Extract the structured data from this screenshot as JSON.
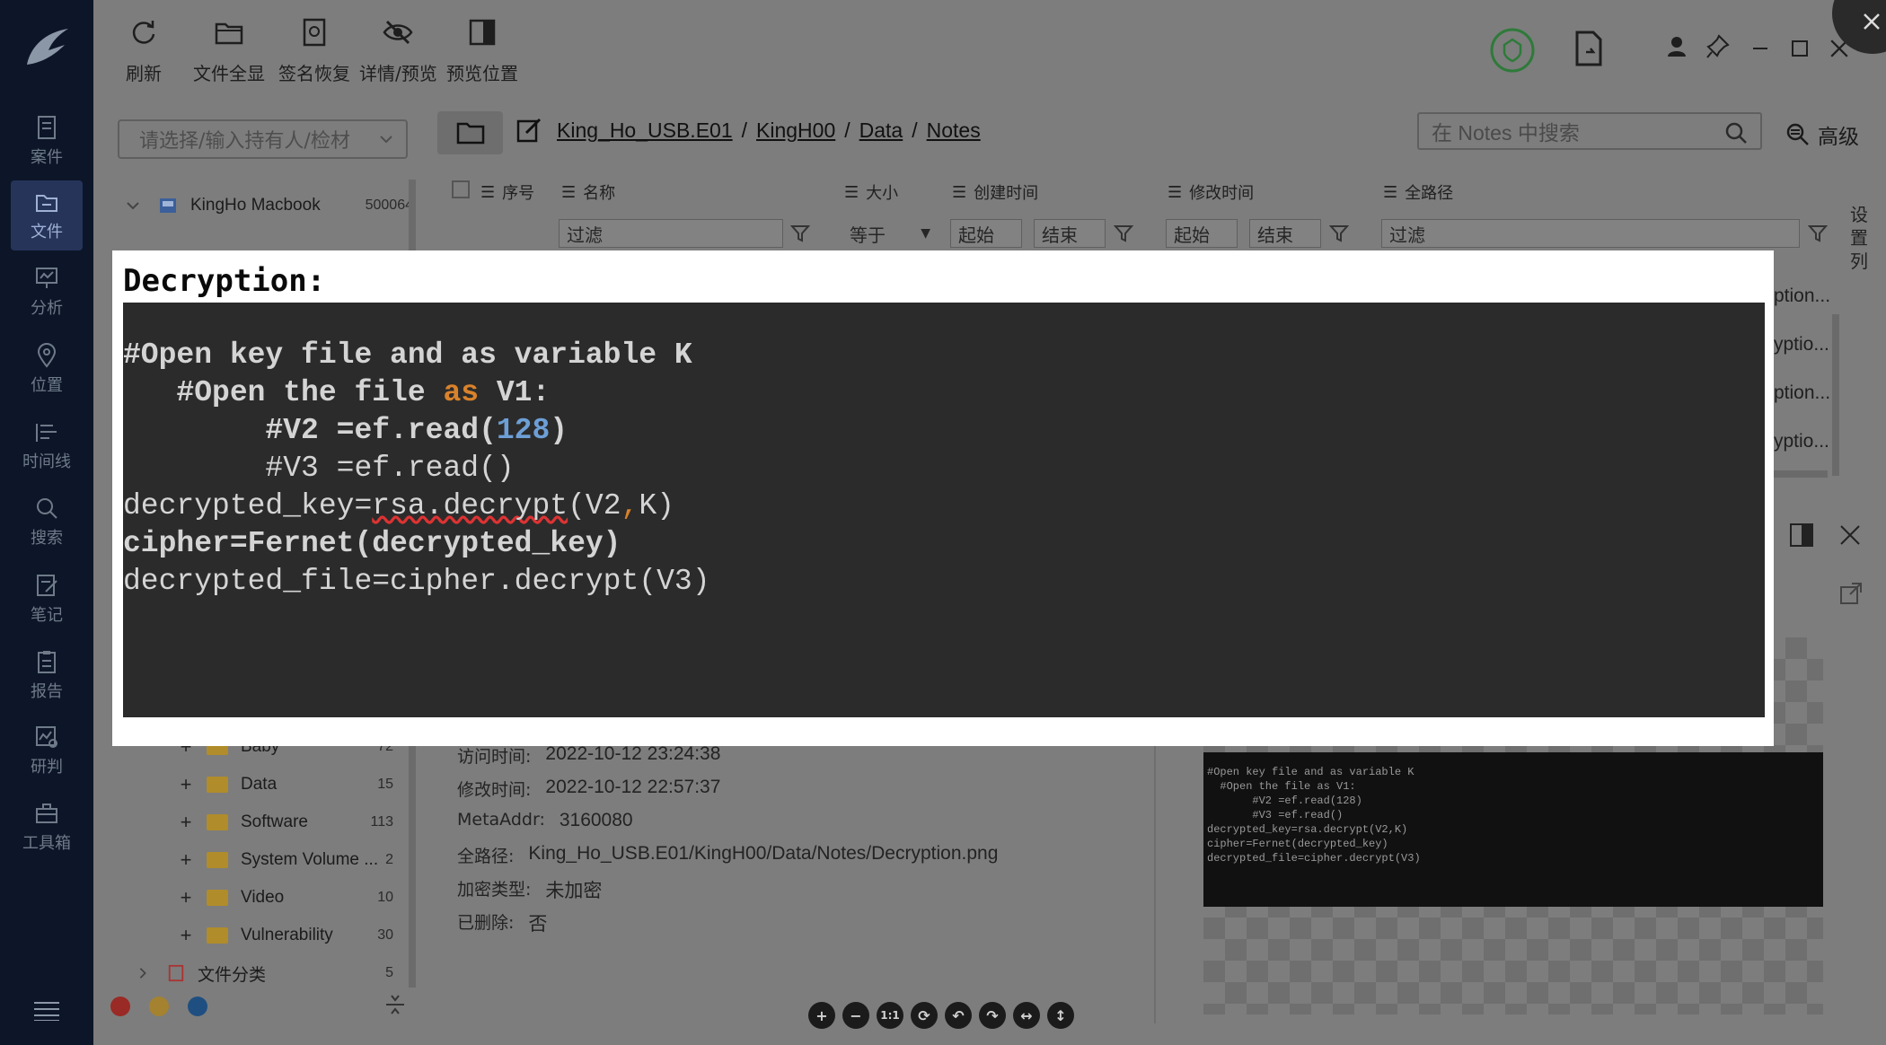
{
  "nav": {
    "items": [
      {
        "label": "案件"
      },
      {
        "label": "文件"
      },
      {
        "label": "分析"
      },
      {
        "label": "位置"
      },
      {
        "label": "时间线"
      },
      {
        "label": "搜索"
      },
      {
        "label": "笔记"
      },
      {
        "label": "报告"
      },
      {
        "label": "研判"
      },
      {
        "label": "工具箱"
      }
    ]
  },
  "toolbar": {
    "refresh": "刷新",
    "file_overview": "文件全显",
    "sig_recovery": "签名恢复",
    "details_preview": "详情/预览",
    "preview_position": "预览位置"
  },
  "owner_select": {
    "placeholder": "请选择/输入持有人/检材"
  },
  "breadcrumb": [
    "King_Ho_USB.E01",
    "KingH00",
    "Data",
    "Notes"
  ],
  "search": {
    "placeholder": "在 Notes 中搜索",
    "advanced": "高级"
  },
  "tree": {
    "root": {
      "label": "KingHo Macbook",
      "count": "500064"
    },
    "folders": [
      {
        "label": "Baby",
        "count": "72"
      },
      {
        "label": "Data",
        "count": "15"
      },
      {
        "label": "Software",
        "count": "113"
      },
      {
        "label": "System Volume ...",
        "count": "2"
      },
      {
        "label": "Video",
        "count": "10"
      },
      {
        "label": "Vulnerability",
        "count": "30"
      }
    ],
    "category": {
      "label": "文件分类",
      "count": "5"
    }
  },
  "table": {
    "columns": [
      "序号",
      "名称",
      "大小",
      "创建时间",
      "修改时间",
      "全路径"
    ],
    "filter_placeholder": "过滤",
    "size_op": "等于",
    "start": "起始",
    "end": "结束",
    "side_label": "设置列",
    "partial_rows": [
      "ption...",
      "yptio...",
      "ption...",
      "yptio..."
    ]
  },
  "details": [
    {
      "label": "访问时间:",
      "value": "2022-10-12 23:24:38"
    },
    {
      "label": "修改时间:",
      "value": "2022-10-12 22:57:37"
    },
    {
      "label": "MetaAddr:",
      "value": "3160080"
    },
    {
      "label": "全路径:",
      "value": "King_Ho_USB.E01/KingH00/Data/Notes/Decryption.png"
    },
    {
      "label": "加密类型:",
      "value": "未加密"
    },
    {
      "label": "已删除:",
      "value": "否"
    }
  ],
  "popup": {
    "title": "Decryption:",
    "line1": "#Open key file and as variable K",
    "line2_a": "   #Open the file ",
    "line2_kw": "as",
    "line2_b": " V1:",
    "line3_a": "        #V2 =ef.read(",
    "line3_num": "128",
    "line3_b": ")",
    "line4": "        #V3 =ef.read()",
    "line5_a": "decrypted_key=",
    "line5_sq": "rsa.decrypt",
    "line5_b": "(V2",
    "line5_comma": ",",
    "line5_c": "K)",
    "line6": "cipher=Fernet(decrypted_key)",
    "line7": "decrypted_file=cipher.decrypt(V3)"
  },
  "thumb_lines": [
    "#Open key file and as variable K",
    "  #Open the file as V1:",
    "       #V2 =ef.read(128)",
    "       #V3 =ef.read()",
    "decrypted_key=rsa.decrypt(V2,K)",
    "cipher=Fernet(decrypted_key)",
    "decrypted_file=cipher.decrypt(V3)"
  ],
  "zoom": [
    "+",
    "−",
    "1:1",
    "⟳",
    "↶",
    "↷",
    "↔",
    "↕"
  ],
  "colors": {
    "accent": "#26345a",
    "popup_code_bg": "#2b2b2b",
    "keyword": "#d9822b",
    "number": "#6d9fd6"
  }
}
